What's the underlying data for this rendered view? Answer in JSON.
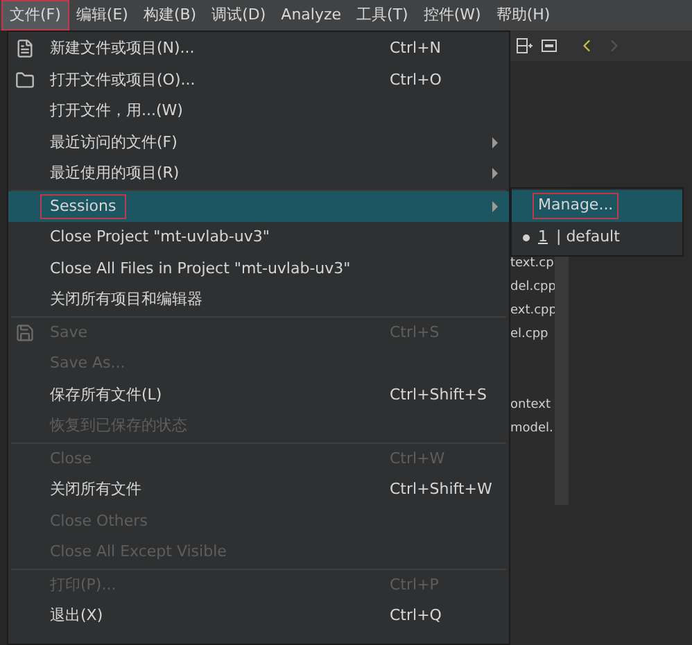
{
  "menubar": [
    {
      "label": "文件(F)",
      "selected": true
    },
    {
      "label": "编辑(E)",
      "selected": false
    },
    {
      "label": "构建(B)",
      "selected": false
    },
    {
      "label": "调试(D)",
      "selected": false
    },
    {
      "label": "Analyze",
      "selected": false
    },
    {
      "label": "工具(T)",
      "selected": false
    },
    {
      "label": "控件(W)",
      "selected": false
    },
    {
      "label": "帮助(H)",
      "selected": false
    }
  ],
  "file_menu": [
    {
      "kind": "item",
      "label": "新建文件或项目(N)...",
      "shortcut": "Ctrl+N",
      "disabled": false,
      "submenu": false,
      "selected": false
    },
    {
      "kind": "item",
      "label": "打开文件或项目(O)...",
      "shortcut": "Ctrl+O",
      "disabled": false,
      "submenu": false,
      "selected": false
    },
    {
      "kind": "item",
      "label": "打开文件，用...(W)",
      "disabled": false,
      "submenu": false,
      "selected": false
    },
    {
      "kind": "item",
      "label": "最近访问的文件(F)",
      "disabled": false,
      "submenu": true,
      "selected": false
    },
    {
      "kind": "item",
      "label": "最近使用的项目(R)",
      "disabled": false,
      "submenu": true,
      "selected": false
    },
    {
      "kind": "separator"
    },
    {
      "kind": "item",
      "label": "Sessions",
      "disabled": false,
      "submenu": true,
      "selected": true
    },
    {
      "kind": "item",
      "label": "Close Project \"mt-uvlab-uv3\"",
      "disabled": false,
      "submenu": false,
      "selected": false
    },
    {
      "kind": "item",
      "label": "Close All Files in Project \"mt-uvlab-uv3\"",
      "disabled": false,
      "submenu": false,
      "selected": false
    },
    {
      "kind": "item",
      "label": "关闭所有项目和编辑器",
      "disabled": false,
      "submenu": false,
      "selected": false
    },
    {
      "kind": "separator"
    },
    {
      "kind": "item",
      "label": "Save",
      "shortcut": "Ctrl+S",
      "disabled": true,
      "submenu": false,
      "selected": false
    },
    {
      "kind": "item",
      "label": "Save As...",
      "disabled": true,
      "submenu": false,
      "selected": false
    },
    {
      "kind": "item",
      "label": "保存所有文件(L)",
      "shortcut": "Ctrl+Shift+S",
      "disabled": false,
      "submenu": false,
      "selected": false
    },
    {
      "kind": "item",
      "label": "恢复到已保存的状态",
      "disabled": true,
      "submenu": false,
      "selected": false
    },
    {
      "kind": "separator"
    },
    {
      "kind": "item",
      "label": "Close",
      "shortcut": "Ctrl+W",
      "disabled": true,
      "submenu": false,
      "selected": false
    },
    {
      "kind": "item",
      "label": "关闭所有文件",
      "shortcut": "Ctrl+Shift+W",
      "disabled": false,
      "submenu": false,
      "selected": false
    },
    {
      "kind": "item",
      "label": "Close Others",
      "disabled": true,
      "submenu": false,
      "selected": false
    },
    {
      "kind": "item",
      "label": "Close All Except Visible",
      "disabled": true,
      "submenu": false,
      "selected": false
    },
    {
      "kind": "separator"
    },
    {
      "kind": "item",
      "label": "打印(P)...",
      "shortcut": "Ctrl+P",
      "disabled": true,
      "submenu": false,
      "selected": false
    },
    {
      "kind": "item",
      "label": "退出(X)",
      "shortcut": "Ctrl+Q",
      "disabled": false,
      "submenu": false,
      "selected": false
    }
  ],
  "sessions_submenu": [
    {
      "kind": "item",
      "label": "Manage...",
      "selected": true,
      "checked": false
    },
    {
      "kind": "item",
      "number": "1",
      "label": "| default",
      "selected": false,
      "checked": true
    }
  ],
  "file_list": [
    {
      "name": "text.cp"
    },
    {
      "name": "del.cpp"
    },
    {
      "name": "ext.cpp"
    },
    {
      "name": "el.cpp"
    },
    {
      "name": "ontext"
    },
    {
      "name": "model."
    }
  ]
}
